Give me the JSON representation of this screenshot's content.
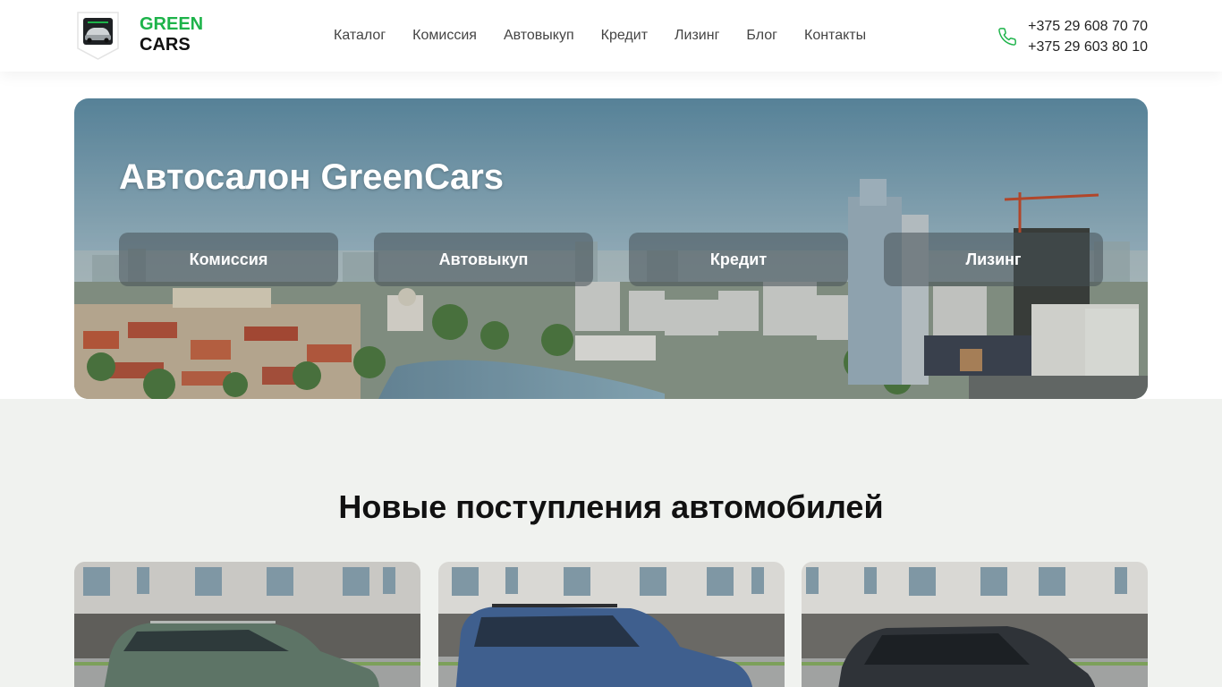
{
  "brand": {
    "line1": "GREEN",
    "line2": "CARS",
    "green": "#1db34a"
  },
  "nav": [
    {
      "label": "Каталог"
    },
    {
      "label": "Комиссия"
    },
    {
      "label": "Автовыкуп"
    },
    {
      "label": "Кредит"
    },
    {
      "label": "Лизинг"
    },
    {
      "label": "Блог"
    },
    {
      "label": "Контакты"
    }
  ],
  "contacts": {
    "icon": "phone-icon",
    "phones": [
      "+375 29 608 70 70",
      "+375 29 603 80 10"
    ]
  },
  "hero": {
    "title": "Автосалон GreenCars",
    "buttons": [
      {
        "label": "Комиссия"
      },
      {
        "label": "Автовыкуп"
      },
      {
        "label": "Кредит"
      },
      {
        "label": "Лизинг"
      }
    ]
  },
  "arrivals": {
    "title": "Новые поступления автомобилей",
    "cards": [
      {
        "car_color": "#5d7466"
      },
      {
        "car_color": "#3f5f8e"
      },
      {
        "car_color": "#2f3338"
      }
    ]
  }
}
